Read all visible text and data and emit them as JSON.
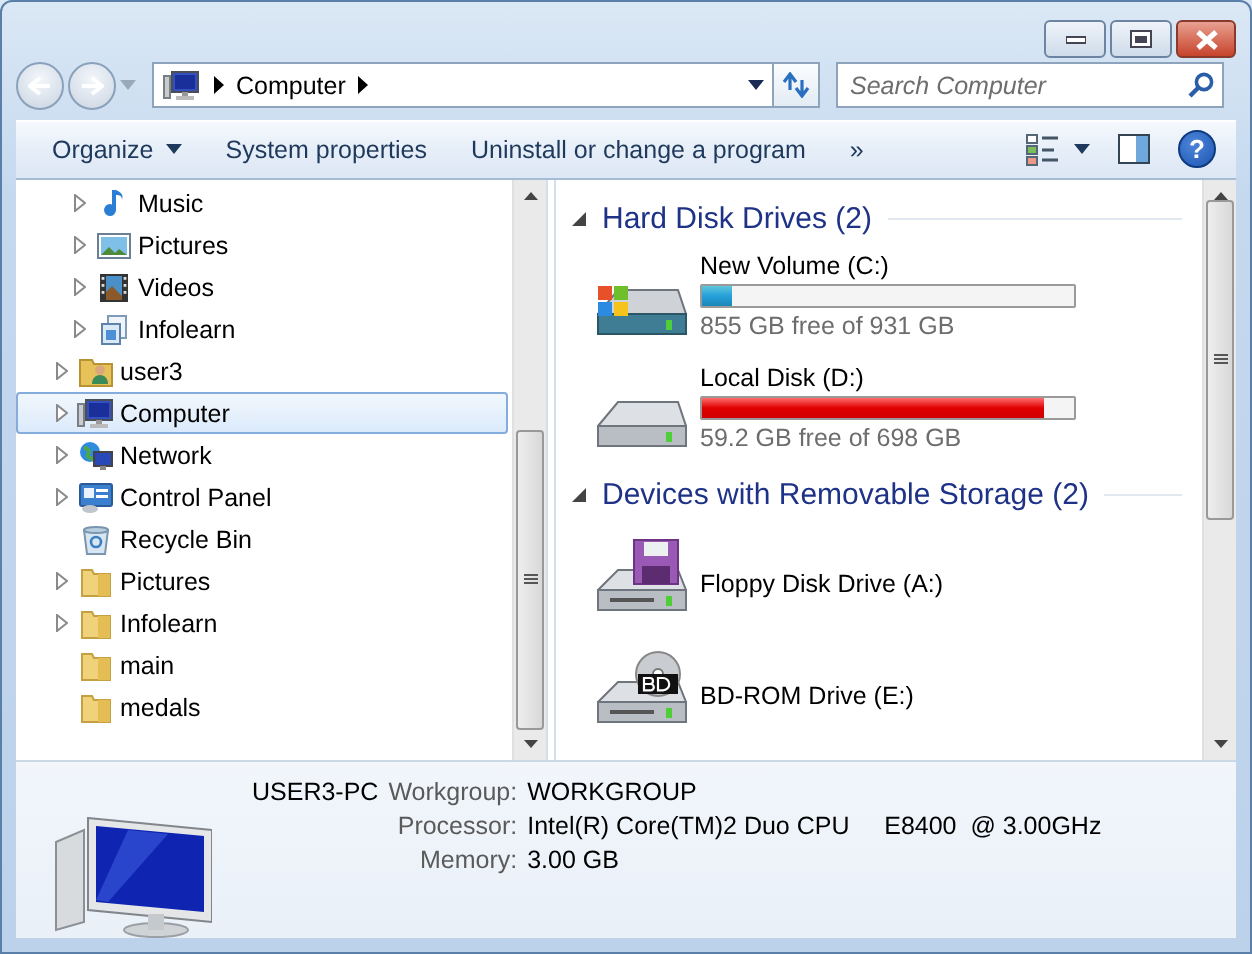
{
  "address": {
    "path": [
      "Computer"
    ]
  },
  "search": {
    "placeholder": "Search Computer"
  },
  "toolbar": [
    {
      "label": "Organize",
      "kind": "menu"
    },
    {
      "label": "System properties",
      "kind": "button"
    },
    {
      "label": "Uninstall or change a program",
      "kind": "button"
    },
    {
      "label": "»",
      "kind": "overflow"
    }
  ],
  "help": {
    "label": "?"
  },
  "tree": [
    {
      "kind": "continued",
      "children": [
        {
          "label": "Music",
          "kind": "music",
          "expandable": true,
          "selected": false
        },
        {
          "label": "Pictures",
          "kind": "picture",
          "expandable": true,
          "selected": false
        },
        {
          "label": "Videos",
          "kind": "film",
          "expandable": true,
          "selected": false
        },
        {
          "label": "Infolearn",
          "kind": "library",
          "expandable": true,
          "selected": false
        }
      ]
    },
    {
      "label": "user3",
      "kind": "user-folder",
      "expandable": true,
      "selected": false
    },
    {
      "label": "Computer",
      "kind": "computer",
      "expandable": true,
      "selected": true
    },
    {
      "label": "Network",
      "kind": "network",
      "expandable": true,
      "selected": false
    },
    {
      "label": "Control Panel",
      "kind": "control-panel",
      "expandable": true,
      "selected": false
    },
    {
      "label": "Recycle Bin",
      "kind": "recycle",
      "expandable": false,
      "selected": false
    },
    {
      "label": "Pictures",
      "kind": "folder",
      "expandable": true,
      "selected": false
    },
    {
      "label": "Infolearn",
      "kind": "folder",
      "expandable": true,
      "selected": false
    },
    {
      "label": "main",
      "kind": "folder",
      "expandable": false,
      "selected": false
    },
    {
      "label": "medals",
      "kind": "folder",
      "expandable": false,
      "selected": false
    }
  ],
  "sections": [
    {
      "title": "Hard Disk Drives (2)",
      "expanded": true,
      "items": [
        {
          "name": "New Volume (C:)",
          "kind": "system-drive",
          "level": 0.08,
          "alert": false,
          "free": "855 GB free of 931 GB"
        },
        {
          "name": "Local Disk (D:)",
          "kind": "drive",
          "level": 0.92,
          "alert": true,
          "free": "59.2 GB free of 698 GB"
        }
      ]
    },
    {
      "title": "Devices with Removable Storage (2)",
      "expanded": true,
      "items": [
        {
          "name": "Floppy Disk Drive (A:)",
          "kind": "floppy"
        },
        {
          "name": "BD-ROM Drive (E:)",
          "kind": "bd"
        }
      ]
    }
  ],
  "details": {
    "name": "USER3-PC",
    "rows": [
      {
        "label": "Workgroup:",
        "value": "WORKGROUP"
      },
      {
        "label": "Processor:",
        "value": "Intel(R) Core(TM)2 Duo CPU     E8400  @ 3.00GHz"
      },
      {
        "label": "Memory:",
        "value": "3.00 GB"
      }
    ]
  }
}
